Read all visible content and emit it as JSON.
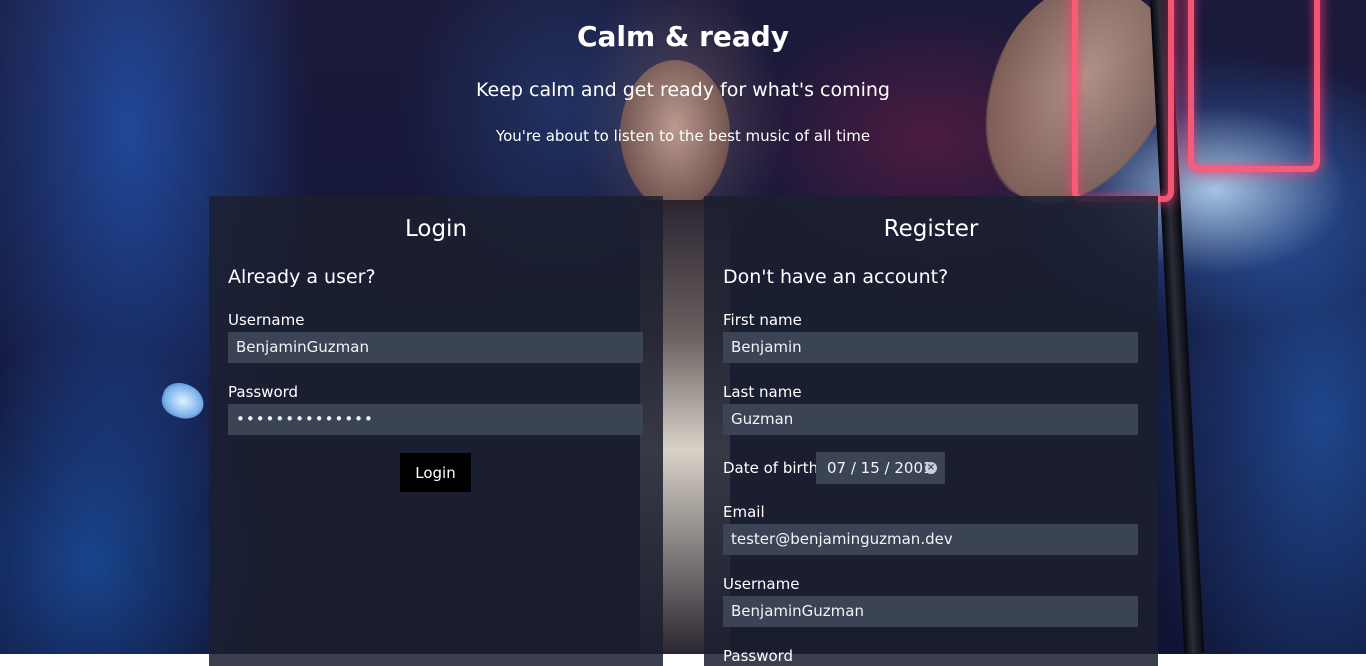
{
  "header": {
    "title": "Calm & ready",
    "subtitle": "Keep calm and get ready for what's coming",
    "tagline": "You're about to listen to the best music of all time"
  },
  "login": {
    "title": "Login",
    "subtitle": "Already a user?",
    "username_label": "Username",
    "username_value": "BenjaminGuzman",
    "password_label": "Password",
    "password_value": "••••••••••••••",
    "button_label": "Login"
  },
  "register": {
    "title": "Register",
    "subtitle": "Don't have an account?",
    "first_name_label": "First name",
    "first_name_value": "Benjamin",
    "last_name_label": "Last name",
    "last_name_value": "Guzman",
    "dob_label": "Date of birth",
    "dob_value": "07 / 15 / 2001",
    "email_label": "Email",
    "email_value": "tester@benjaminguzman.dev",
    "username_label": "Username",
    "username_value": "BenjaminGuzman",
    "password_label": "Password"
  },
  "icons": {
    "dob_clear": "clear-icon"
  }
}
